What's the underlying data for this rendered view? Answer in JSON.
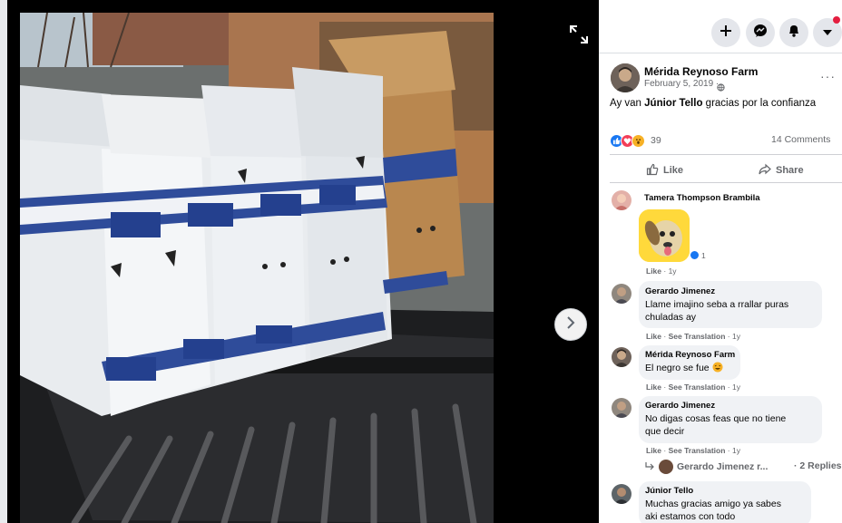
{
  "colors": {
    "accent": "#1877f2",
    "bubble": "#f0f2f5",
    "notification": "#e41e3f",
    "secondary_text": "#65676b"
  },
  "topbar": {
    "icons": [
      "plus-icon",
      "messenger-icon",
      "bell-icon",
      "caret-down-icon"
    ]
  },
  "post": {
    "page_name": "Mérida Reynoso Farm",
    "date": "February 5, 2019 ·",
    "more": "···",
    "text_intro": "Ay van ",
    "text_mention": "Júnior Tello",
    "text_rest": " gracias por la confianza",
    "reactions_count": "39",
    "comments_count": "14 Comments",
    "like_label": "Like",
    "share_label": "Share"
  },
  "comments": [
    {
      "name": "Tamera Thompson Brambila",
      "text": "",
      "meta_action": "Like",
      "meta_rest": " · 1y",
      "sticker_reactions": "1"
    },
    {
      "name": "Gerardo Jimenez",
      "line1": "Llame imajino seba a rrallar puras",
      "line2": "chuladas ay",
      "meta_action": "Like",
      "meta_translate": "See Translation",
      "meta_rest": " · 1y"
    },
    {
      "name": "Mérida Reynoso Farm",
      "line1": "El negro se fue",
      "meta_action": "Like",
      "meta_translate": "See Translation",
      "meta_rest": " · 1y"
    },
    {
      "name": "Gerardo Jimenez",
      "line1": "No digas cosas feas que no tiene",
      "line2": "que decir",
      "meta_action": "Like",
      "meta_translate": "See Translation",
      "meta_rest": " · 1y"
    },
    {
      "name": "Júnior Tello",
      "line1": "Muchas gracias amigo ya sabes",
      "line2": "aki estamos con todo"
    }
  ],
  "replies": {
    "label": "Gerardo Jimenez r...",
    "count": "· 2 Replies"
  },
  "meta_sep": " · "
}
